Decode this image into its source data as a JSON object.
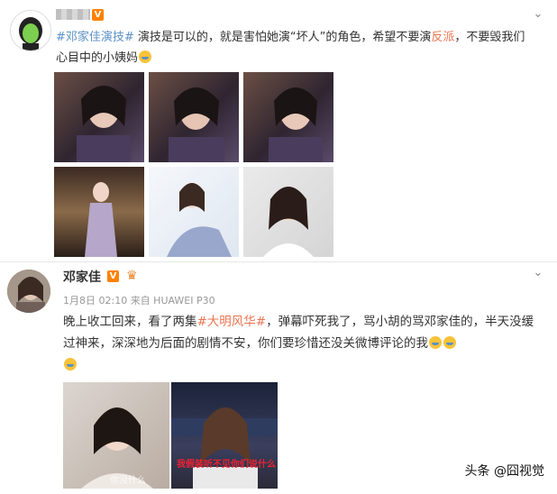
{
  "post1": {
    "username": "",
    "verified_badge": "V",
    "text_tag": "#邓家佳演技#",
    "text_body_a": " 演技是可以的，就是害怕她演“坏人”的角色，希望不要演",
    "text_link": "反派",
    "text_body_b": "，不要毁我们心目中的小姨妈",
    "images": [
      {
        "caption": ""
      },
      {
        "caption": ""
      },
      {
        "caption": ""
      },
      {
        "caption": ""
      },
      {
        "caption": ""
      },
      {
        "caption": ""
      }
    ]
  },
  "post2": {
    "username": "邓家佳",
    "verified_badge": "V",
    "meta": "1月8日 02:10 来自 HUAWEI P30",
    "text_a": "晚上收工回来，看了两集",
    "text_tag": "#大明风华#",
    "text_b": "，弹幕吓死我了，骂小胡的骂邓家佳的，半天没缓过神来，深深地为后面的剧情不安，你们要珍惜还没关微博评论的我",
    "img1_caption": "你没什么",
    "img2_caption": "我假装听不见你们说什么"
  },
  "watermark": "头条 @囧视觉",
  "icons": {
    "chevron": "chevron-down-icon",
    "emblem": "crown-emblem-icon"
  },
  "colors": {
    "link": "#eb7350",
    "tag": "#5b91c6",
    "badge": "#ff8200"
  }
}
